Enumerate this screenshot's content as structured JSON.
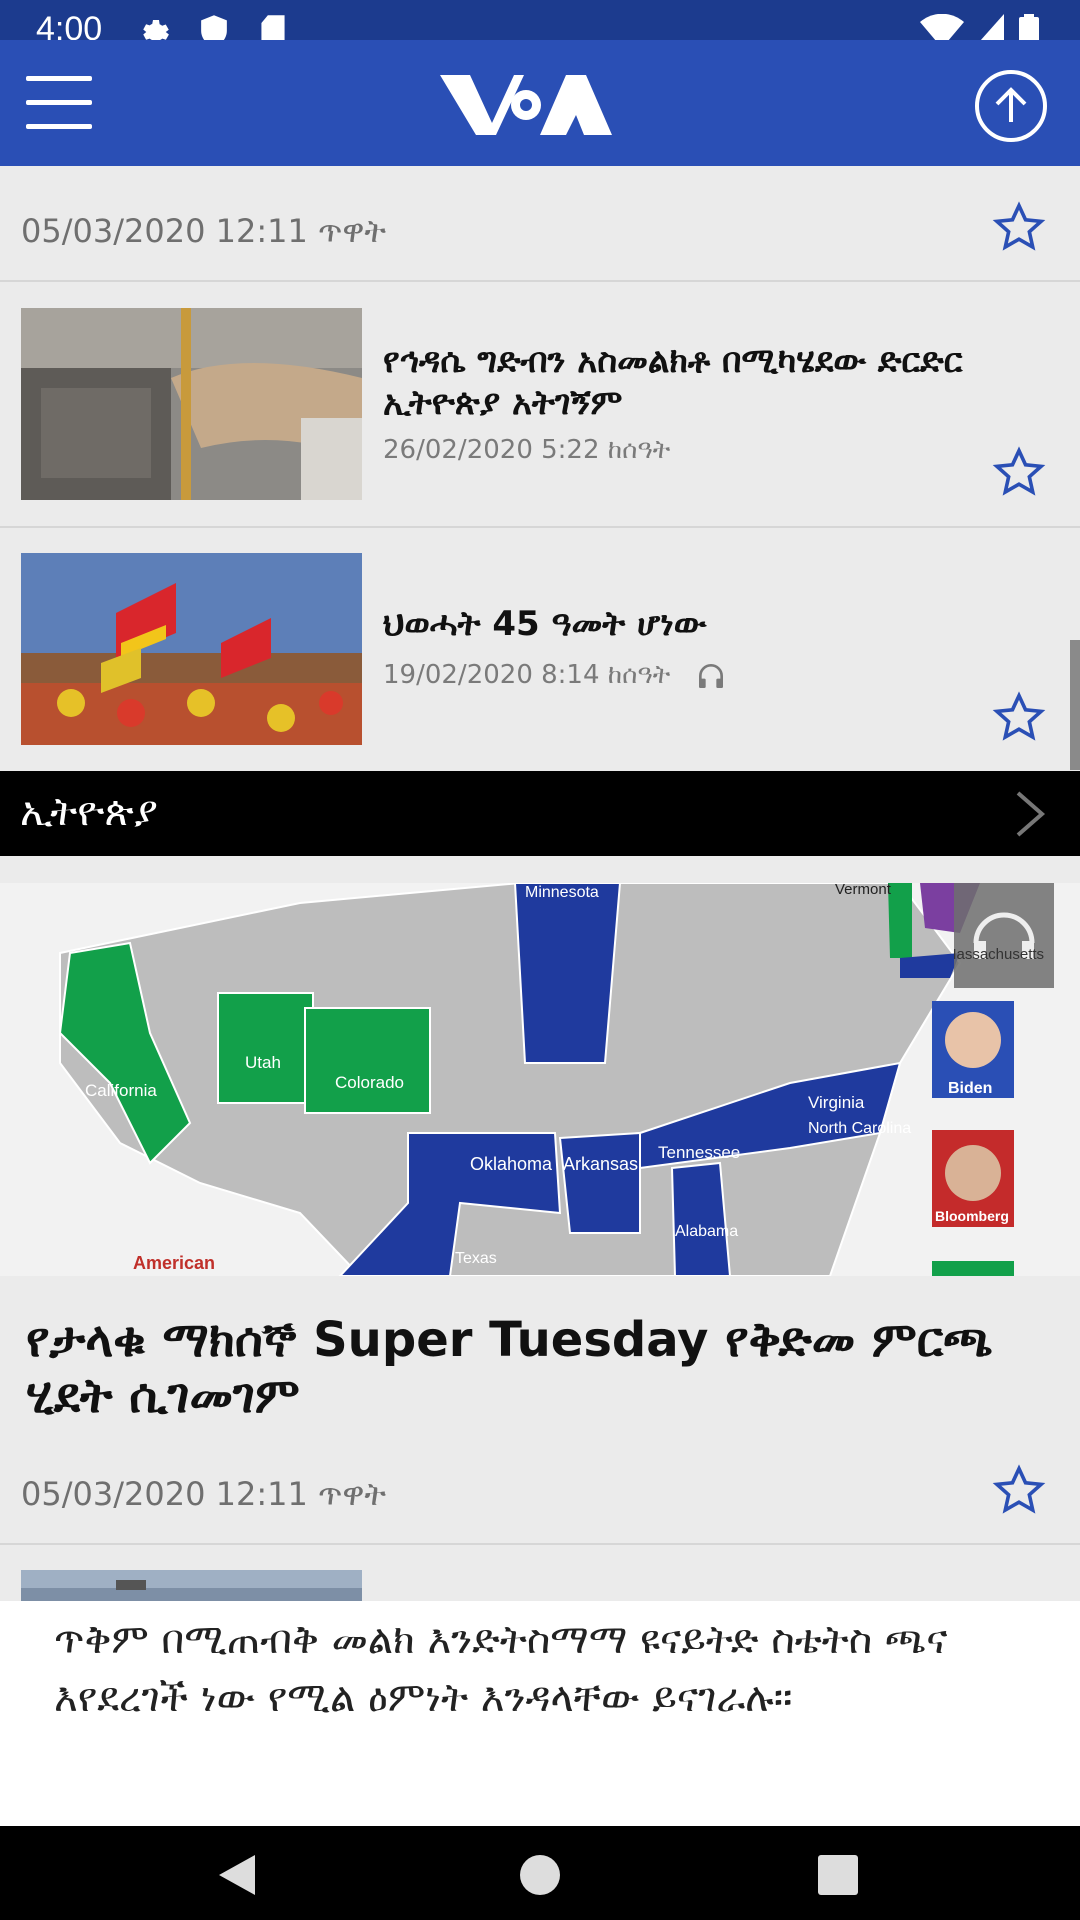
{
  "status_bar": {
    "time": "4:00"
  },
  "app_bar": {
    "logo_text": "VOA"
  },
  "top_row": {
    "date": "05/03/2020 12:11 ጥዋት"
  },
  "articles": [
    {
      "title": "የኅዳሴ ግድብን አስመልክቶ በሚካሄደው ድርድር ኢትዮጵያ አትገኝም",
      "date": "26/02/2020 5:22 ከሰዓት",
      "has_audio": false
    },
    {
      "title": "ህወሓት 45 ዓመት ሆነው",
      "date": "19/02/2020 8:14 ከሰዓት",
      "has_audio": true
    }
  ],
  "section": {
    "label": "ኢትዮጵያ"
  },
  "hero": {
    "title": "የታላቁ ማክሰኞ Super Tuesday የቅድመ ምርጫ ሂደት ሲገመገም",
    "date": "05/03/2020 12:11 ጥዋት",
    "map_labels": {
      "minnesota": "Minnesota",
      "vermont": "Vermont",
      "massachusetts": "Massachusetts",
      "california": "California",
      "utah": "Utah",
      "colorado": "Colorado",
      "oklahoma": "Oklahoma",
      "arkansas": "Arkansas",
      "tennessee": "Tennessee",
      "virginia": "Virginia",
      "north_carolina": "North Carolina",
      "alabama": "Alabama",
      "texas": "Texas",
      "american": "American",
      "biden": "Biden",
      "bloomberg": "Bloomberg"
    }
  },
  "excerpt": {
    "text": "ጥቅም በሚጠብቅ መልክ እንድትስማማ ዩናይትድ ስቴትስ ጫና እየደረገች ነው የሚል ዕምነት እንዳላቸው ይናገራሉ።"
  },
  "colors": {
    "appbar": "#2a4fb5",
    "statusbar": "#1c3b8e",
    "star": "#2a4fb5",
    "green": "#12a04a",
    "blue": "#1f3a9e"
  },
  "icons": [
    "settings-icon",
    "shield-icon",
    "sdcard-icon",
    "wifi-icon",
    "signal-icon",
    "battery-icon",
    "menu-icon",
    "scroll-up-icon",
    "star-icon",
    "headphones-icon",
    "chevron-right-icon",
    "back-icon",
    "home-icon",
    "recents-icon"
  ]
}
